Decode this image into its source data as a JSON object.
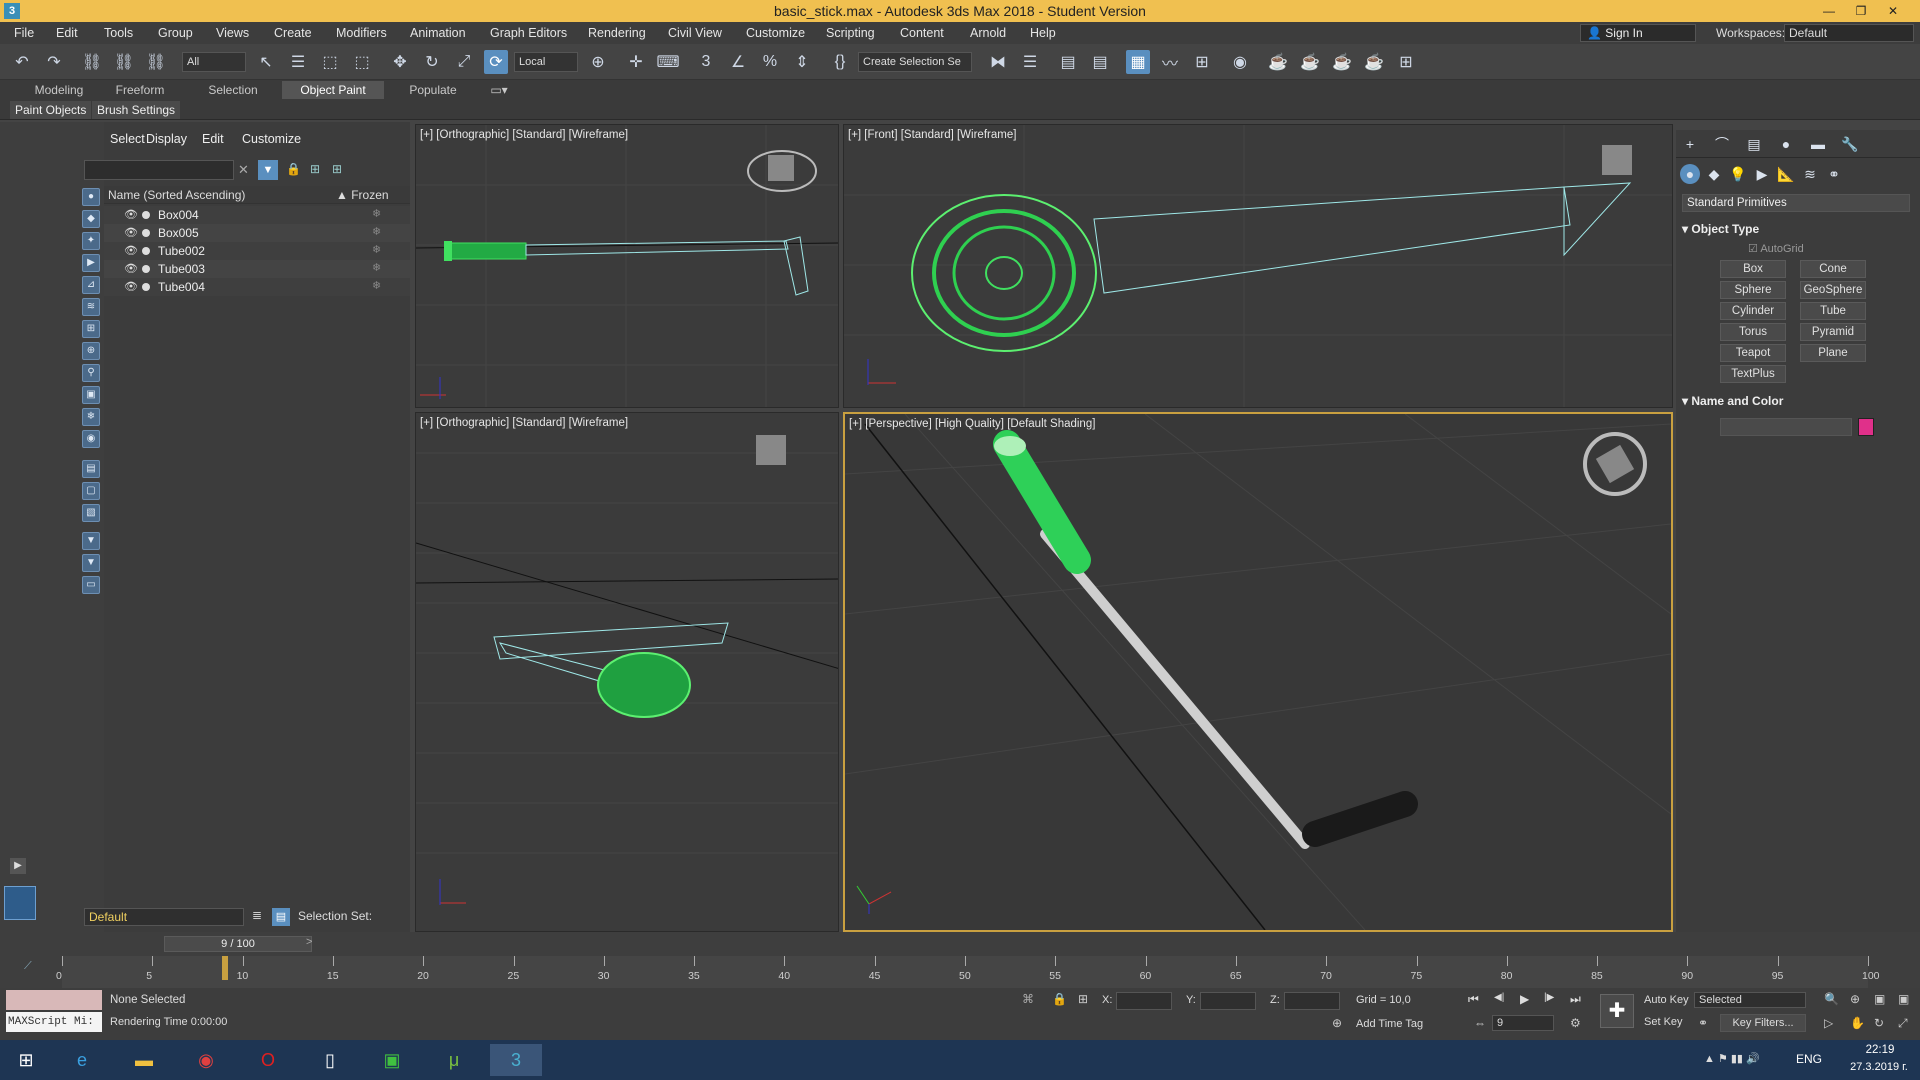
{
  "window": {
    "title": "basic_stick.max - Autodesk 3ds Max 2018 - Student Version",
    "app_glyph": "3",
    "btn_minimize": "—",
    "btn_restore": "❐",
    "btn_close": "✕"
  },
  "menus": [
    "File",
    "Edit",
    "Tools",
    "Group",
    "Views",
    "Create",
    "Modifiers",
    "Animation",
    "Graph Editors",
    "Rendering",
    "Civil View",
    "Customize",
    "Scripting",
    "Content",
    "Arnold",
    "Help"
  ],
  "account": {
    "signin": "Sign In",
    "workspaces_label": "Workspaces:",
    "workspace": "Default"
  },
  "toolbar": {
    "filter": "All",
    "coord": "Local",
    "selection_set": "Create Selection Se",
    "glyph_undo": "↶",
    "glyph_redo": "↷",
    "glyph_link": "⛓",
    "glyph_move": "✥",
    "glyph_rotate": "↻",
    "glyph_scale": "⤢",
    "glyph_snap": "3",
    "glyph_angle_snap": "∠",
    "glyph_percent_snap": "%",
    "glyph_spinner_snap": "⇕",
    "glyph_mirror": "⧓",
    "glyph_align": "☰",
    "glyph_render": "☕"
  },
  "ribbon": {
    "tabs": [
      "Modeling",
      "Freeform",
      "Selection",
      "Object Paint",
      "Populate"
    ],
    "active_tab": "Object Paint",
    "subtabs": [
      "Paint Objects",
      "Brush Settings"
    ]
  },
  "explorer": {
    "menu": [
      "Select",
      "Display",
      "Edit",
      "Customize"
    ],
    "clear_glyph": "✕",
    "col_name": "Name (Sorted Ascending)",
    "col_frozen": "▲ Frozen",
    "eye_glyph": "👁",
    "frozen_glyph": "❄",
    "rows": [
      "Box004",
      "Box005",
      "Tube002",
      "Tube003",
      "Tube004"
    ],
    "layer": "Default",
    "selection_set_label": "Selection Set:"
  },
  "viewports": {
    "top_left": "[+] [Orthographic] [Standard] [Wireframe]",
    "top_right": "[+] [Front] [Standard] [Wireframe]",
    "bottom_left": "[+] [Orthographic] [Standard] [Wireframe]",
    "bottom_right": "[+] [Perspective] [High Quality] [Default Shading]"
  },
  "command_panel": {
    "tab_glyphs": [
      "+",
      "⌒",
      "▤",
      "●",
      "▬",
      "🔧"
    ],
    "subtab_glyphs": [
      "●",
      "◆",
      "💡",
      "▶",
      "📐",
      "≋",
      "⚭"
    ],
    "category": "Standard Primitives",
    "object_type_title": "Object Type",
    "autogrid": "AutoGrid",
    "buttons": [
      "Box",
      "Cone",
      "Sphere",
      "GeoSphere",
      "Cylinder",
      "Tube",
      "Torus",
      "Pyramid",
      "Teapot",
      "Plane",
      "TextPlus"
    ],
    "name_color_title": "Name and Color",
    "color": "#e0308a"
  },
  "timeline": {
    "slider": "9 / 100",
    "ticks": [
      "0",
      "5",
      "10",
      "15",
      "20",
      "25",
      "30",
      "35",
      "40",
      "45",
      "50",
      "55",
      "60",
      "65",
      "70",
      "75",
      "80",
      "85",
      "90",
      "95",
      "100"
    ]
  },
  "status": {
    "selection": "None Selected",
    "render_time": "Rendering Time  0:00:00",
    "x_label": "X:",
    "y_label": "Y:",
    "z_label": "Z:",
    "grid": "Grid = 10,0",
    "add_time_tag": "Add Time Tag",
    "auto_key": "Auto Key",
    "selected": "Selected",
    "set_key": "Set Key",
    "key_filters": "Key Filters...",
    "frame": "9",
    "maxscript": "MAXScript Mi:",
    "glyph_first": "⏮",
    "glyph_prev": "◀|",
    "glyph_play": "▶",
    "glyph_next": "|▶",
    "glyph_last": "⏭",
    "glyph_key": "✚"
  },
  "taskbar": {
    "start_glyph": "⊞",
    "apps": [
      "ie",
      "explorer",
      "chrome",
      "opera",
      "notepad",
      "store",
      "utorrent",
      "3dsmax"
    ],
    "lang": "ENG",
    "time": "22:19",
    "date": "27.3.2019 г."
  }
}
